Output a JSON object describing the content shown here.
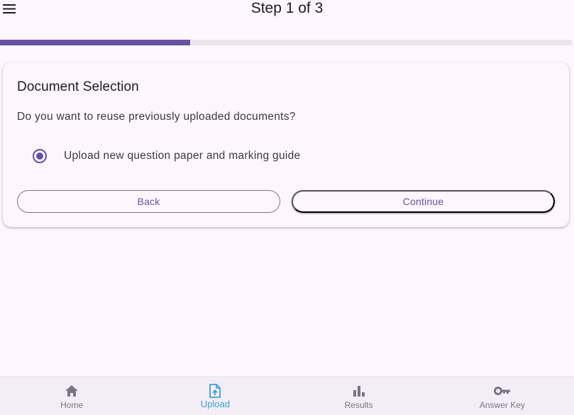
{
  "appbar": {
    "title": "Step 1 of 3",
    "menu_icon": "hamburger-menu-icon"
  },
  "progress": {
    "fraction": 0.333
  },
  "card": {
    "title": "Document Selection",
    "question": "Do you want to reuse previously uploaded documents?",
    "option": {
      "label": "Upload new question paper and marking guide",
      "selected": true
    },
    "back_label": "Back",
    "continue_label": "Continue"
  },
  "bottom_nav": {
    "items": [
      {
        "label": "Home",
        "icon": "home-icon",
        "active": false
      },
      {
        "label": "Upload",
        "icon": "upload-file-icon",
        "active": true
      },
      {
        "label": "Results",
        "icon": "bar-chart-icon",
        "active": false
      },
      {
        "label": "Answer Key",
        "icon": "key-icon",
        "active": false
      }
    ]
  },
  "colors": {
    "primary": "#6750a4",
    "active_nav": "#3b9fd6",
    "inactive_nav": "#7a7580",
    "background": "#fef7ff"
  }
}
